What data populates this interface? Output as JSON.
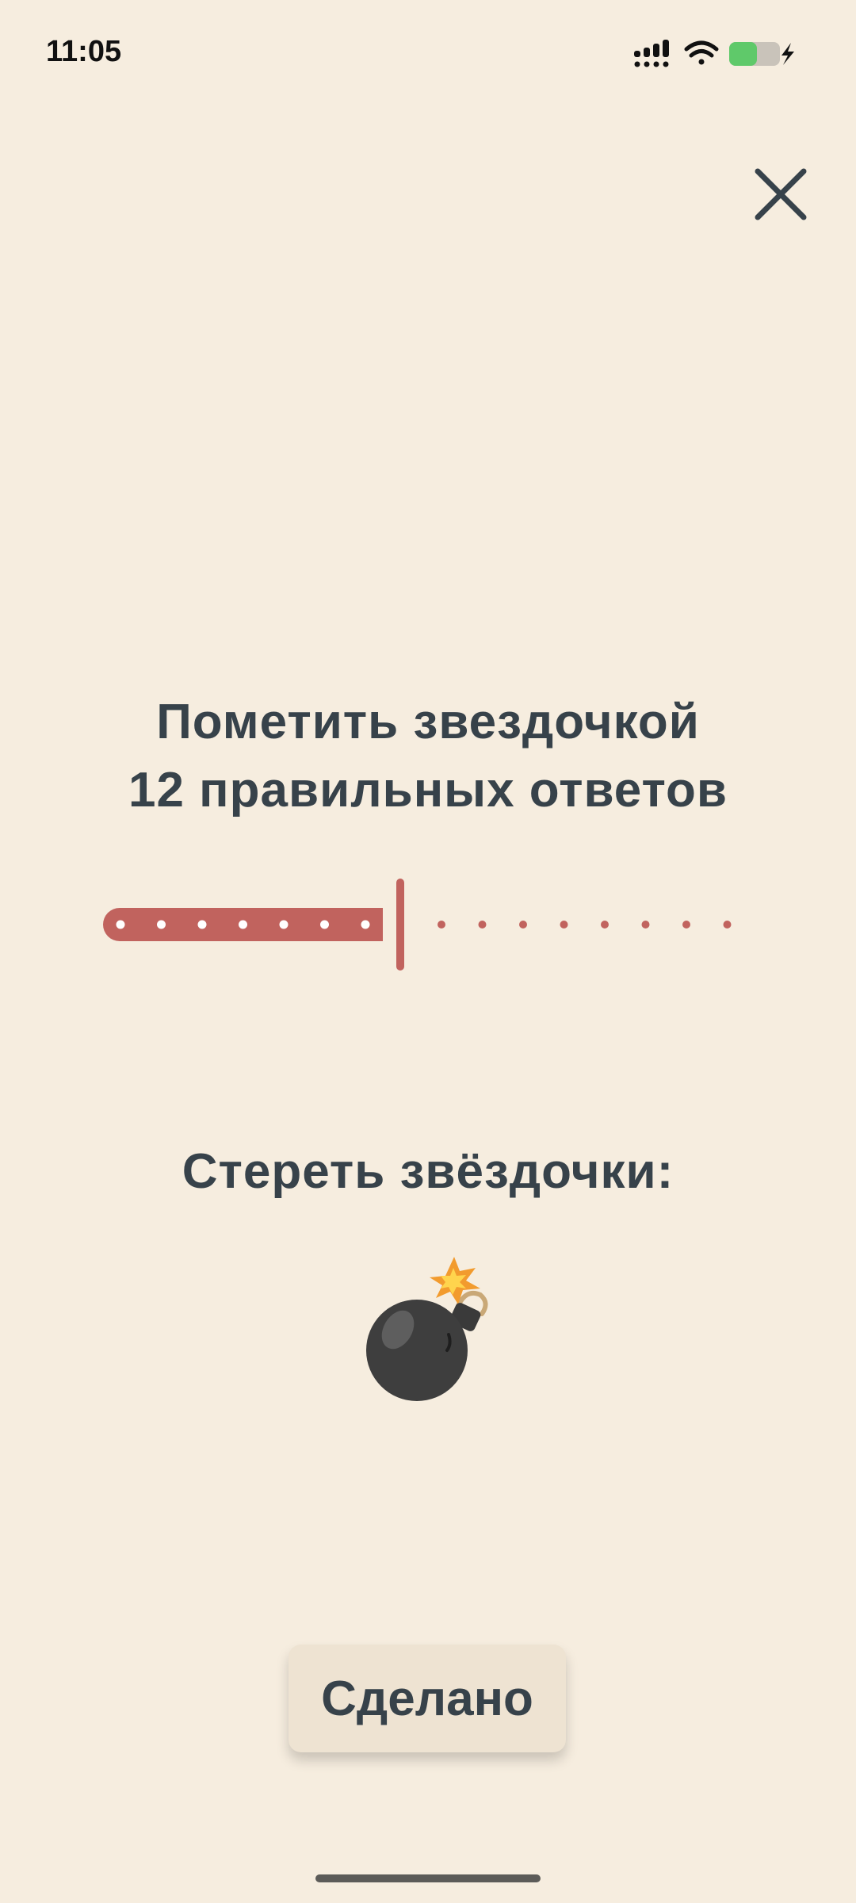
{
  "status_bar": {
    "time": "11:05",
    "battery_level": 0.55
  },
  "icons": {
    "signal": "cellular-signal-icon",
    "wifi": "wifi-icon",
    "battery": "battery-charging-icon",
    "close": "close-icon",
    "bomb": "bomb-icon"
  },
  "title": {
    "line1": "Пометить звездочкой",
    "line2": "12 правильных ответов"
  },
  "slider": {
    "selected_steps": 7,
    "total_steps": 15,
    "color": "#C1635E"
  },
  "erase": {
    "label": "Стереть звёздочки:"
  },
  "done_button": {
    "label": "Сделано"
  },
  "colors": {
    "background": "#F6EDDF",
    "text": "#37424A",
    "accent": "#C1635E",
    "button_bg": "#EEE3D2"
  }
}
